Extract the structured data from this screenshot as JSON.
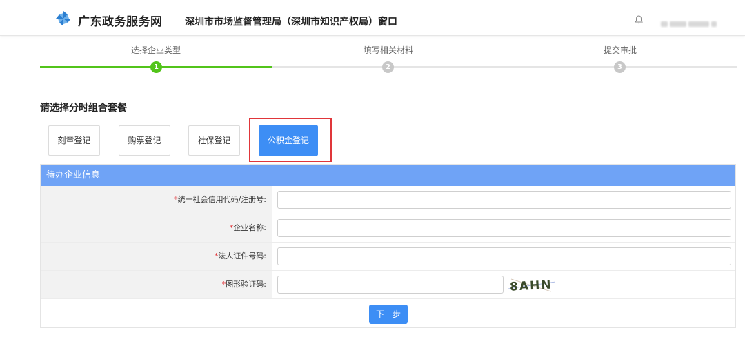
{
  "header": {
    "site_name": "广东政务服务网",
    "window_title": "深圳市市场监督管理局（深圳市知识产权局）窗口",
    "icons": {
      "logo": "pinwheel-logo-icon",
      "notification": "bell-icon"
    },
    "colors": {
      "logo_blue": "#2c7fd1"
    }
  },
  "steps": {
    "items": [
      {
        "label": "选择企业类型",
        "number": "1",
        "status": "active"
      },
      {
        "label": "填写相关材料",
        "number": "2",
        "status": "pending"
      },
      {
        "label": "提交审批",
        "number": "3",
        "status": "pending"
      }
    ],
    "colors": {
      "active": "#52c41a",
      "pending": "#c8c8c8",
      "line_pending": "#e5e5e5"
    }
  },
  "packages": {
    "title": "请选择分时组合套餐",
    "items": [
      {
        "label": "刻章登记",
        "selected": false
      },
      {
        "label": "购票登记",
        "selected": false
      },
      {
        "label": "社保登记",
        "selected": false
      },
      {
        "label": "公积金登记",
        "selected": true
      }
    ]
  },
  "form": {
    "panel_title": "待办企业信息",
    "fields": [
      {
        "required_mark": "*",
        "label": "统一社会信用代码/注册号:",
        "value": ""
      },
      {
        "required_mark": "*",
        "label": "企业名称:",
        "value": ""
      },
      {
        "required_mark": "*",
        "label": "法人证件号码:",
        "value": ""
      },
      {
        "required_mark": "*",
        "label": "图形验证码:",
        "value": ""
      }
    ],
    "captcha_text": "8AHN",
    "next_label": "下一步",
    "colors": {
      "panel_header": "#6fa3f6",
      "primary": "#3d8ef5",
      "required": "#e0363a",
      "highlight": "#e0363a"
    }
  }
}
